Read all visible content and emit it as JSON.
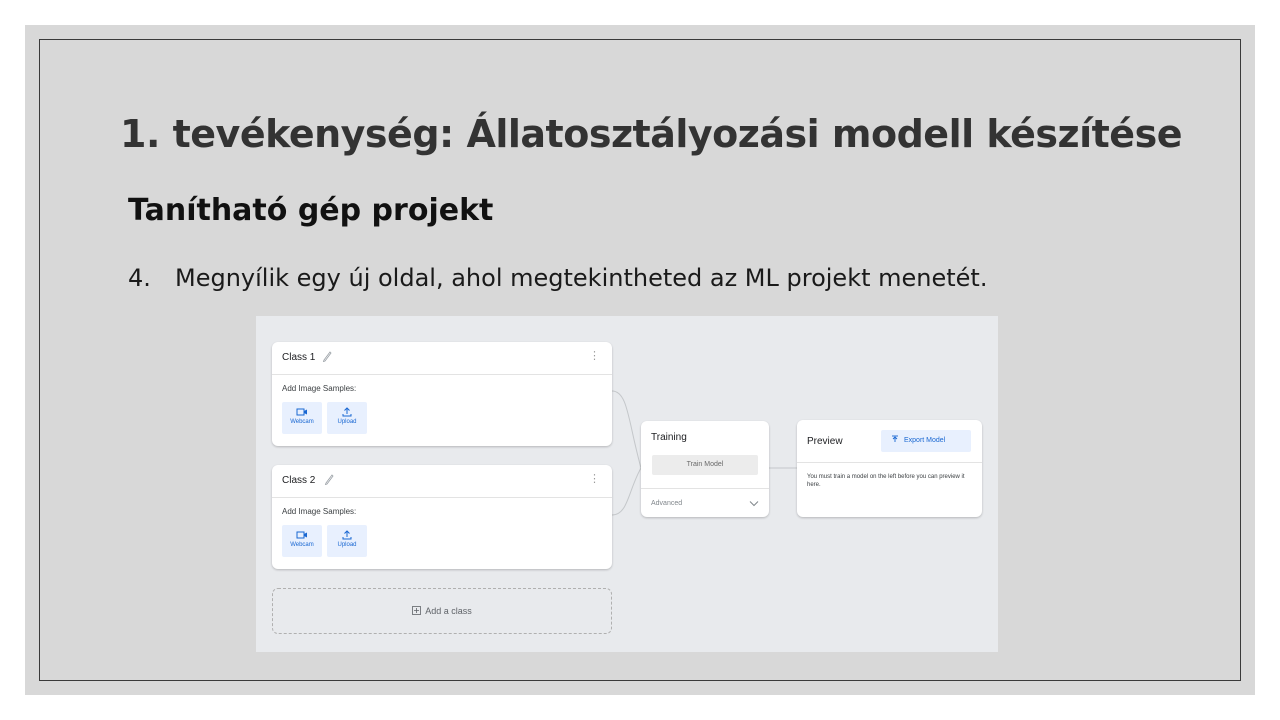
{
  "slide": {
    "title": "1. tevékenység: Állatosztályozási modell készítése",
    "subtitle": "Tanítható gép projekt",
    "step_number": "4.",
    "step_text": "Megnyílik egy új oldal, ahol megtekintheted az ML projekt menetét."
  },
  "screenshot": {
    "classes": [
      {
        "name": "Class 1",
        "samples_label": "Add Image Samples:",
        "webcam_label": "Webcam",
        "upload_label": "Upload"
      },
      {
        "name": "Class 2",
        "samples_label": "Add Image Samples:",
        "webcam_label": "Webcam",
        "upload_label": "Upload"
      }
    ],
    "add_class_label": "Add a class",
    "training": {
      "title": "Training",
      "train_button": "Train Model",
      "advanced_label": "Advanced"
    },
    "preview": {
      "title": "Preview",
      "export_button": "Export Model",
      "message": "You must train a model on the left before you can preview it here."
    }
  },
  "icons": {
    "edit": "pencil-icon",
    "menu": "kebab-menu-icon",
    "webcam": "video-camera-icon",
    "upload": "upload-icon",
    "add": "plus-box-icon",
    "expand": "chevron-down-icon",
    "export": "export-icon"
  },
  "colors": {
    "slide_background": "#d8d8d8",
    "accent_blue": "#1967d2",
    "tool_button_bg": "#e8f0fe"
  }
}
